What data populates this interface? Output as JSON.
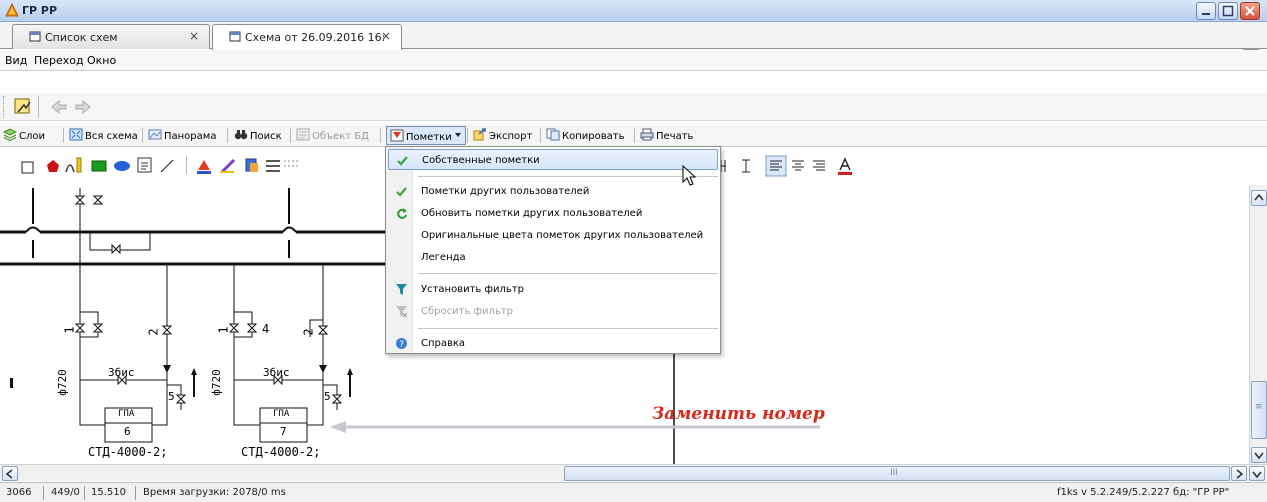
{
  "window": {
    "title": "ГР РР"
  },
  "tabs": [
    {
      "label": "Список схем",
      "close": "×",
      "active": false
    },
    {
      "label": "Схема от 26.09.2016 16:",
      "close": "×",
      "active": true
    }
  ],
  "menubar": {
    "items": [
      "Вид",
      "Переход",
      "Окно"
    ]
  },
  "toolbar2": {
    "items": [
      {
        "label": "Слои",
        "icon": "layers-icon"
      },
      {
        "label": "Вся схема",
        "icon": "fit-all-icon"
      },
      {
        "label": "Панорама",
        "icon": "panorama-icon"
      },
      {
        "label": "Поиск",
        "icon": "binoculars-icon"
      },
      {
        "label": "Объект БД",
        "icon": "db-object-icon",
        "disabled": true
      },
      {
        "label": "Пометки",
        "icon": "marks-icon",
        "dropdown": true,
        "active": true
      },
      {
        "label": "Экспорт",
        "icon": "export-icon"
      },
      {
        "label": "Копировать",
        "icon": "copy-icon"
      },
      {
        "label": "Печать",
        "icon": "print-icon"
      }
    ]
  },
  "dropdown": {
    "items": [
      {
        "label": "Собственные пометки",
        "icon": "check-icon",
        "highlighted": true
      },
      {
        "label": "Пометки других пользователей",
        "icon": "check-icon"
      },
      {
        "label": "Обновить пометки других пользователей",
        "icon": "refresh-icon"
      },
      {
        "label": "Оригинальные цвета пометок других пользователей"
      },
      {
        "label": "Легенда"
      },
      {
        "label": "Установить фильтр",
        "icon": "filter-icon"
      },
      {
        "label": "Сбросить фильтр",
        "icon": "filter-clear-icon",
        "disabled": true
      },
      {
        "label": "Справка",
        "icon": "help-icon"
      }
    ]
  },
  "diagram": {
    "labels": {
      "n1": "1",
      "n2a": "2",
      "n4": "4",
      "n2b": "2",
      "d720a": "ф720",
      "d720b": "ф720",
      "zbis_a": "3бис",
      "zbis_b": "3бис",
      "n5a": "5",
      "n5b": "5",
      "gpa_a": "ГПА",
      "gpa_a_num": "6",
      "gpa_b": "ГПА",
      "gpa_b_num": "7",
      "std_a": "СТД-4000-2;",
      "std_b": "СТД-4000-2;"
    },
    "annotation": "Заменить номер",
    "annotation_color": "#d6281b"
  },
  "statusbar": {
    "items": [
      "3066",
      "449/0",
      "15.510",
      "Время загрузки: 2078/0 ms"
    ],
    "right": "f1ks  v 5.2.249/5.2.227  бд: \"ГР РР\""
  },
  "hscroll": {
    "grip": "III"
  },
  "vscroll": {
    "grip": "≡"
  }
}
